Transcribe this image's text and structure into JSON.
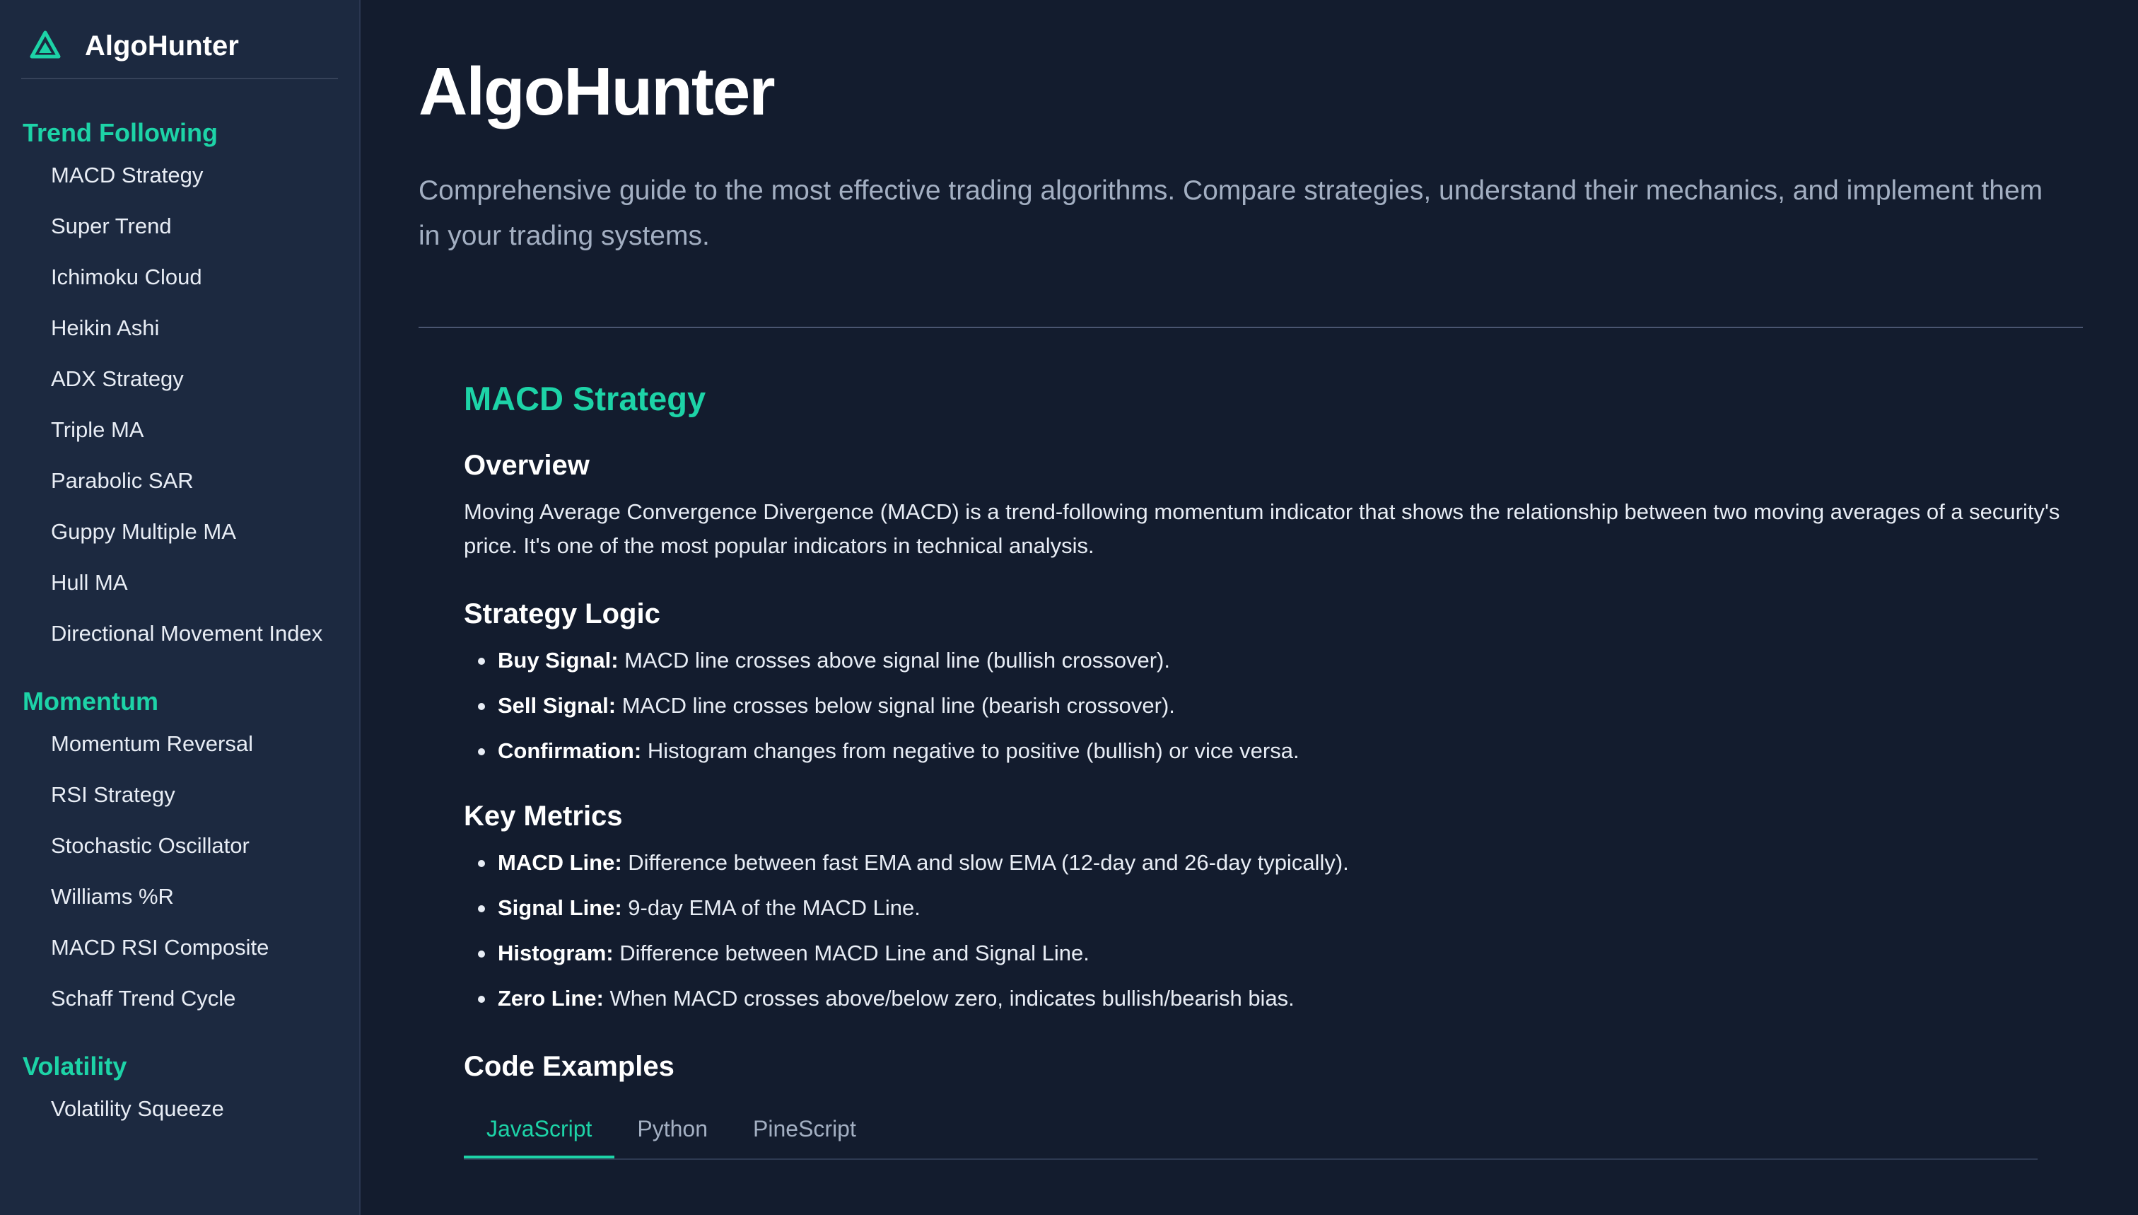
{
  "app": {
    "brand_name": "AlgoHunter",
    "accent_color": "#1dd3a7",
    "brand_icon": "triangle-logo-icon"
  },
  "sidebar": {
    "sections": [
      {
        "heading": "Trend Following",
        "items": [
          "MACD Strategy",
          "Super Trend",
          "Ichimoku Cloud",
          "Heikin Ashi",
          "ADX Strategy",
          "Triple MA",
          "Parabolic SAR",
          "Guppy Multiple MA",
          "Hull MA",
          "Directional Movement Index"
        ]
      },
      {
        "heading": "Momentum",
        "items": [
          "Momentum Reversal",
          "RSI Strategy",
          "Stochastic Oscillator",
          "Williams %R",
          "MACD RSI Composite",
          "Schaff Trend Cycle"
        ]
      },
      {
        "heading": "Volatility",
        "items": [
          "Volatility Squeeze"
        ]
      }
    ]
  },
  "main": {
    "title": "AlgoHunter",
    "description": "Comprehensive guide to the most effective trading algorithms. Compare strategies, understand their mechanics, and implement them in your trading systems.",
    "strategy": {
      "title": "MACD Strategy",
      "overview_heading": "Overview",
      "overview_text": "Moving Average Convergence Divergence (MACD) is a trend-following momentum indicator that shows the relationship between two moving averages of a security's price. It's one of the most popular indicators in technical analysis.",
      "logic_heading": "Strategy Logic",
      "logic_items": [
        {
          "term": "Buy Signal:",
          "text": " MACD line crosses above signal line (bullish crossover)."
        },
        {
          "term": "Sell Signal:",
          "text": " MACD line crosses below signal line (bearish crossover)."
        },
        {
          "term": "Confirmation:",
          "text": " Histogram changes from negative to positive (bullish) or vice versa."
        }
      ],
      "metrics_heading": "Key Metrics",
      "metrics_items": [
        {
          "term": "MACD Line:",
          "text": " Difference between fast EMA and slow EMA (12-day and 26-day typically)."
        },
        {
          "term": "Signal Line:",
          "text": " 9-day EMA of the MACD Line."
        },
        {
          "term": "Histogram:",
          "text": " Difference between MACD Line and Signal Line."
        },
        {
          "term": "Zero Line:",
          "text": " When MACD crosses above/below zero, indicates bullish/bearish bias."
        }
      ],
      "code_heading": "Code Examples",
      "code_tabs": [
        {
          "label": "JavaScript",
          "active": true
        },
        {
          "label": "Python",
          "active": false
        },
        {
          "label": "PineScript",
          "active": false
        }
      ]
    }
  }
}
